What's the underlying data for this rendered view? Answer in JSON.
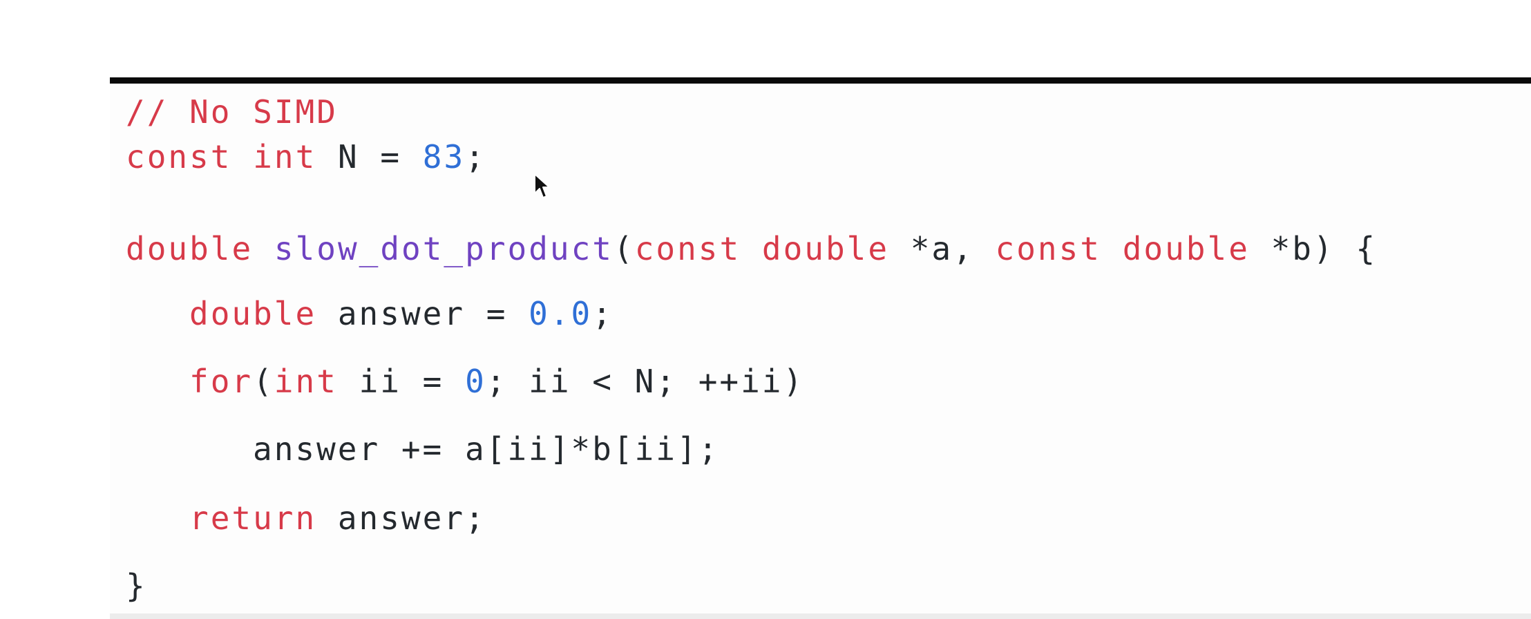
{
  "code": {
    "lines": [
      {
        "tokens": [
          {
            "t": "// No SIMD",
            "k": "cm"
          }
        ]
      },
      {
        "tokens": [
          {
            "t": "const",
            "k": "kw"
          },
          {
            "t": " ",
            "k": "tx"
          },
          {
            "t": "int",
            "k": "kw"
          },
          {
            "t": " N = ",
            "k": "tx"
          },
          {
            "t": "83",
            "k": "num"
          },
          {
            "t": ";",
            "k": "tx"
          }
        ]
      },
      {
        "tokens": [
          {
            "t": "double",
            "k": "kw"
          },
          {
            "t": " ",
            "k": "tx"
          },
          {
            "t": "slow_dot_product",
            "k": "fn"
          },
          {
            "t": "(",
            "k": "tx"
          },
          {
            "t": "const",
            "k": "kw"
          },
          {
            "t": " ",
            "k": "tx"
          },
          {
            "t": "double",
            "k": "kw"
          },
          {
            "t": " *a, ",
            "k": "tx"
          },
          {
            "t": "const",
            "k": "kw"
          },
          {
            "t": " ",
            "k": "tx"
          },
          {
            "t": "double",
            "k": "kw"
          },
          {
            "t": " *b) {",
            "k": "tx"
          }
        ]
      },
      {
        "tokens": [
          {
            "t": "double",
            "k": "kw"
          },
          {
            "t": " answer = ",
            "k": "tx"
          },
          {
            "t": "0.0",
            "k": "num"
          },
          {
            "t": ";",
            "k": "tx"
          }
        ]
      },
      {
        "tokens": [
          {
            "t": "for",
            "k": "kw"
          },
          {
            "t": "(",
            "k": "tx"
          },
          {
            "t": "int",
            "k": "kw"
          },
          {
            "t": " ii = ",
            "k": "tx"
          },
          {
            "t": "0",
            "k": "num"
          },
          {
            "t": "; ii < N; ++ii)",
            "k": "tx"
          }
        ]
      },
      {
        "tokens": [
          {
            "t": "answer += a[ii]*b[ii];",
            "k": "tx"
          }
        ]
      },
      {
        "tokens": [
          {
            "t": "return",
            "k": "kw"
          },
          {
            "t": " answer;",
            "k": "tx"
          }
        ]
      },
      {
        "tokens": [
          {
            "t": "}",
            "k": "tx"
          }
        ]
      }
    ]
  },
  "icons": {
    "cursor": "mouse-pointer-icon"
  }
}
